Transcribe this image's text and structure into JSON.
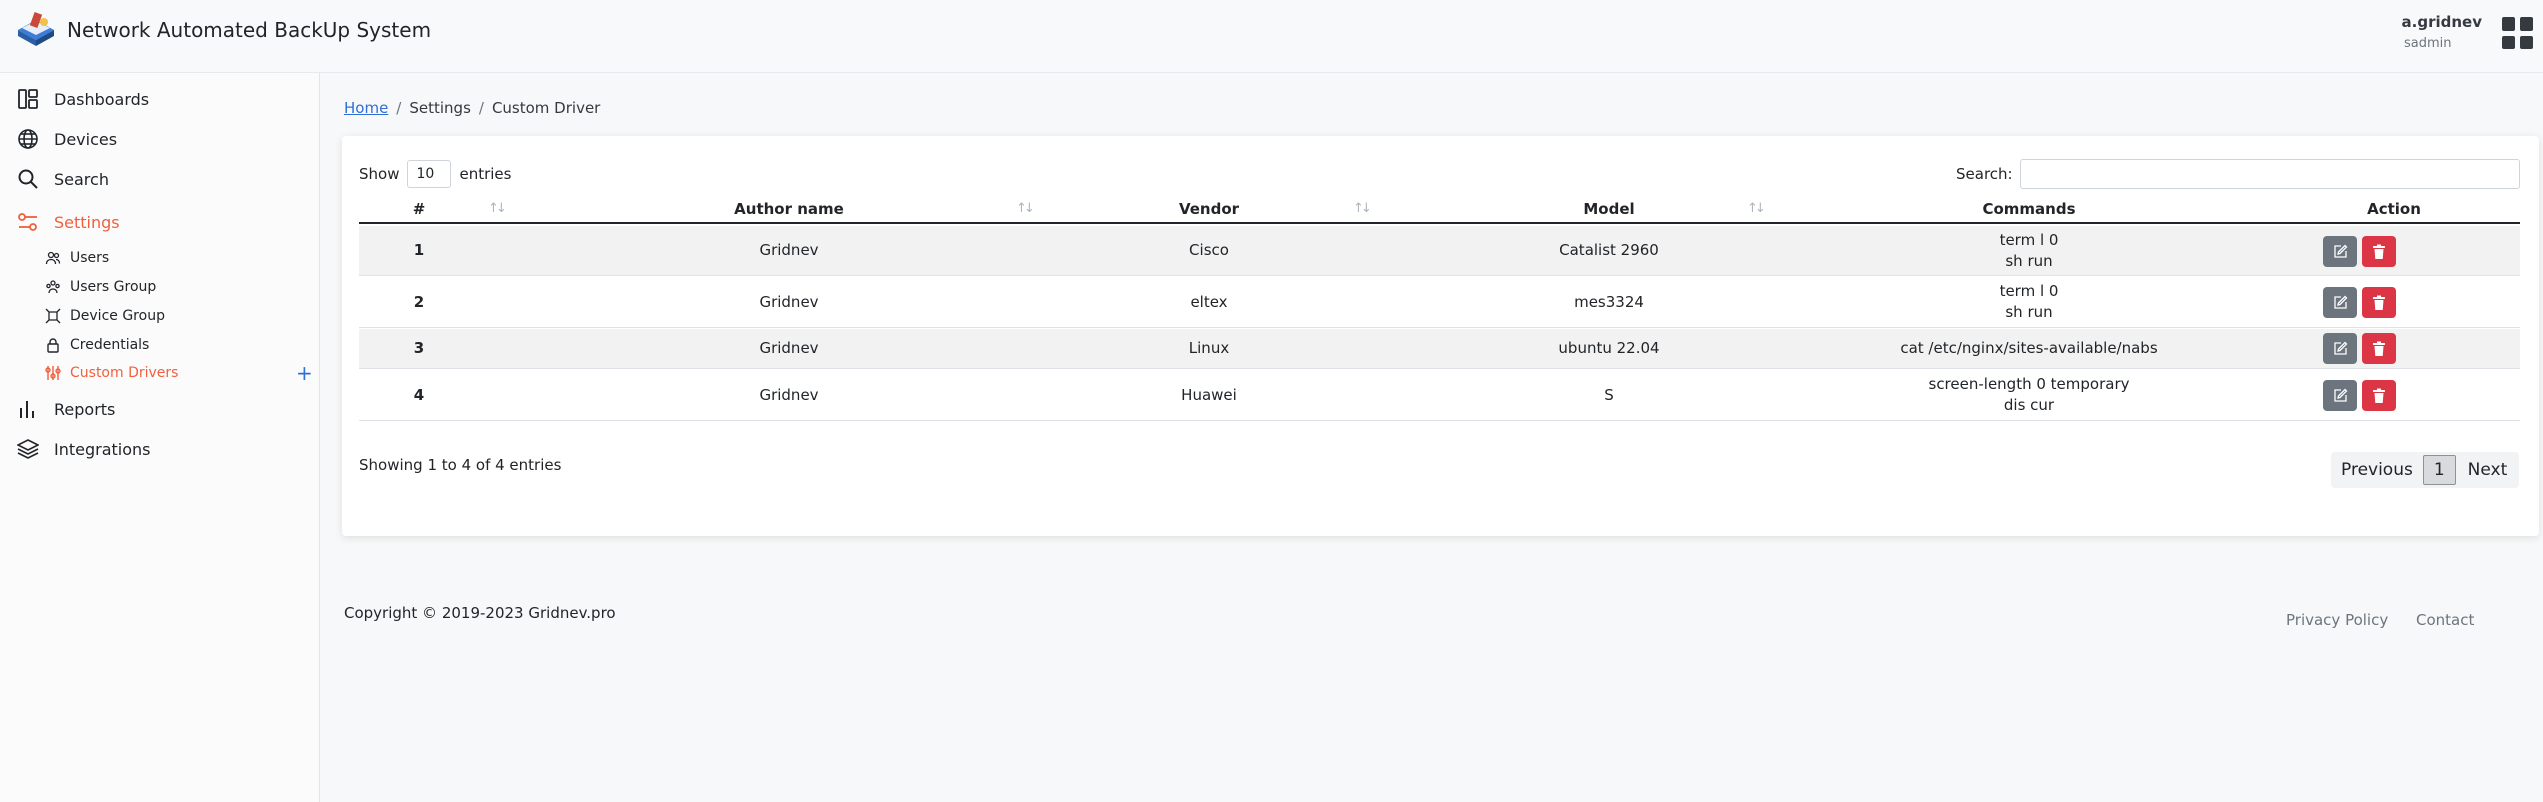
{
  "header": {
    "app_title": "Network Automated BackUp System",
    "user_name": "a.gridnev",
    "user_role": "sadmin",
    "logo_icon": "book-logo-icon",
    "apps_icon": "grid-apps-icon"
  },
  "sidebar": {
    "items": [
      {
        "label": "Dashboards",
        "icon": "dashboard-icon"
      },
      {
        "label": "Devices",
        "icon": "globe-icon"
      },
      {
        "label": "Search",
        "icon": "search-icon"
      },
      {
        "label": "Settings",
        "icon": "sliders-icon",
        "active": true
      },
      {
        "label": "Reports",
        "icon": "bar-chart-icon"
      },
      {
        "label": "Integrations",
        "icon": "layers-icon"
      }
    ],
    "settings_sub": [
      {
        "label": "Users",
        "icon": "users-icon"
      },
      {
        "label": "Users Group",
        "icon": "users-group-icon"
      },
      {
        "label": "Device Group",
        "icon": "device-group-icon"
      },
      {
        "label": "Credentials",
        "icon": "lock-icon"
      },
      {
        "label": "Custom Drivers",
        "icon": "custom-drivers-icon",
        "active": true
      }
    ],
    "add_label": "+"
  },
  "breadcrumb": {
    "home": "Home",
    "settings": "Settings",
    "current": "Custom Driver",
    "separator": "/"
  },
  "table": {
    "show_label": "Show",
    "entries_value": "10",
    "entries_label": "entries",
    "search_label": "Search:",
    "search_value": "",
    "columns": [
      "#",
      "Author name",
      "Vendor",
      "Model",
      "Commands",
      "Action"
    ],
    "rows": [
      {
        "num": "1",
        "author": "Gridnev",
        "vendor": "Cisco",
        "model": "Catalist 2960",
        "commands": [
          "term l 0",
          "sh run"
        ]
      },
      {
        "num": "2",
        "author": "Gridnev",
        "vendor": "eltex",
        "model": "mes3324",
        "commands": [
          "term l 0",
          "sh run"
        ]
      },
      {
        "num": "3",
        "author": "Gridnev",
        "vendor": "Linux",
        "model": "ubuntu 22.04",
        "commands": [
          "cat /etc/nginx/sites-available/nabs"
        ]
      },
      {
        "num": "4",
        "author": "Gridnev",
        "vendor": "Huawei",
        "model": "S",
        "commands": [
          "screen-length 0 temporary",
          "dis cur"
        ]
      }
    ],
    "info": "Showing 1 to 4 of 4 entries",
    "pagination": {
      "previous": "Previous",
      "current": "1",
      "next": "Next"
    }
  },
  "footer": {
    "copyright": "Copyright © 2019-2023 Gridnev.pro",
    "privacy": "Privacy Policy",
    "contact": "Contact"
  },
  "colors": {
    "accent": "#f0603e",
    "link": "#2f6fd6",
    "edit_button": "#6c757d",
    "delete_button": "#dc3545"
  }
}
